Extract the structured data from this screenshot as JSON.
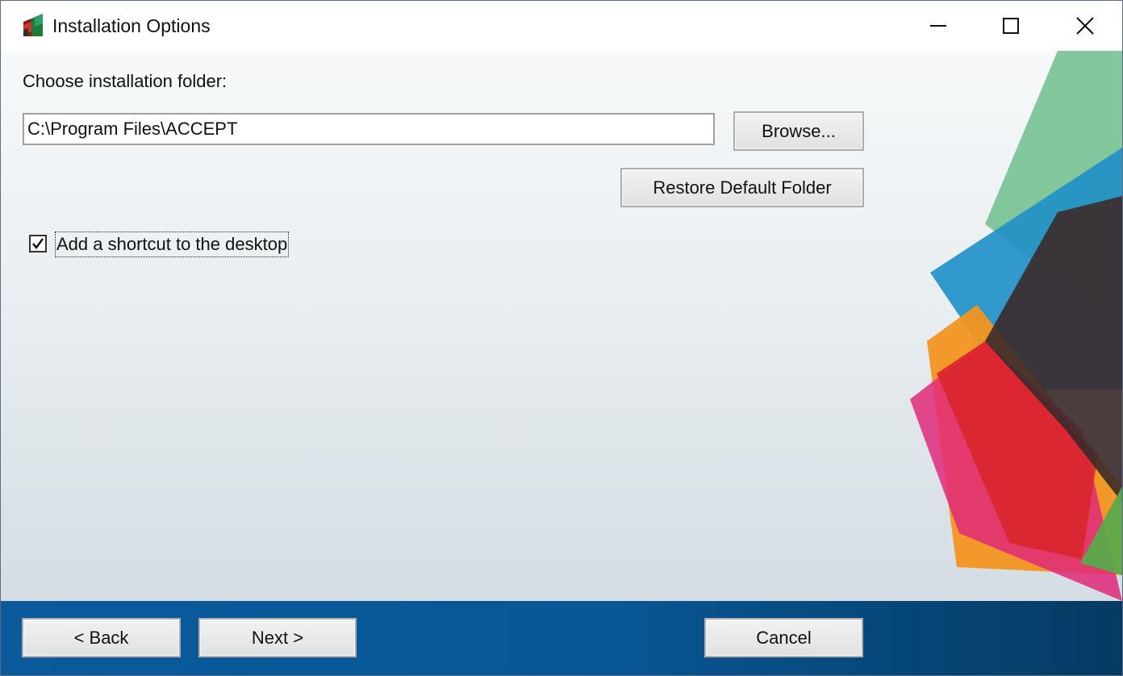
{
  "window": {
    "title": "Installation Options"
  },
  "content": {
    "folder_label": "Choose installation folder:",
    "folder_path": "C:\\Program Files\\ACCEPT",
    "browse_label": "Browse...",
    "restore_label": "Restore Default Folder",
    "shortcut_label": "Add a shortcut to the desktop",
    "shortcut_checked": true
  },
  "footer": {
    "back_label": "< Back",
    "next_label": "Next >",
    "cancel_label": "Cancel"
  },
  "colors": {
    "bottom_bar": "#0a5a9c",
    "decor_green": "#6fc08c",
    "decor_blue": "#1e8fc8",
    "decor_orange": "#f39420",
    "decor_red": "#d9262b",
    "decor_pink": "#e0297a",
    "decor_dark": "#3b2a2a"
  }
}
